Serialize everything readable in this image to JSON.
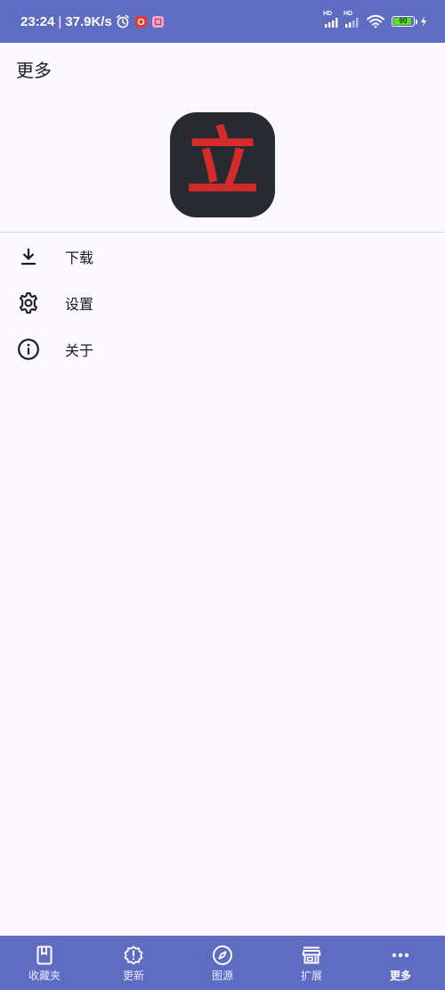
{
  "status_bar": {
    "time": "23:24",
    "separator": "|",
    "network_speed": "37.9K/s",
    "signal_1_label": "HD",
    "signal_2_label": "HD",
    "battery_level": "90",
    "battery_fraction": 0.9,
    "battery_color": "#5ddc2b"
  },
  "header": {
    "title": "更多"
  },
  "logo": {
    "glyph": "立",
    "background": "#272a31",
    "glyph_color": "#d42b2b"
  },
  "menu": {
    "items": [
      {
        "label": "下载",
        "icon": "download-icon"
      },
      {
        "label": "设置",
        "icon": "gear-icon"
      },
      {
        "label": "关于",
        "icon": "info-icon"
      }
    ]
  },
  "bottom_nav": {
    "accent": "#5e6dc2",
    "items": [
      {
        "label": "收藏夹",
        "icon": "bookmark-book-icon"
      },
      {
        "label": "更新",
        "icon": "alert-badge-icon"
      },
      {
        "label": "图源",
        "icon": "compass-icon"
      },
      {
        "label": "扩展",
        "icon": "store-icon"
      },
      {
        "label": "更多",
        "icon": "more-dots-icon",
        "active": true
      }
    ]
  }
}
